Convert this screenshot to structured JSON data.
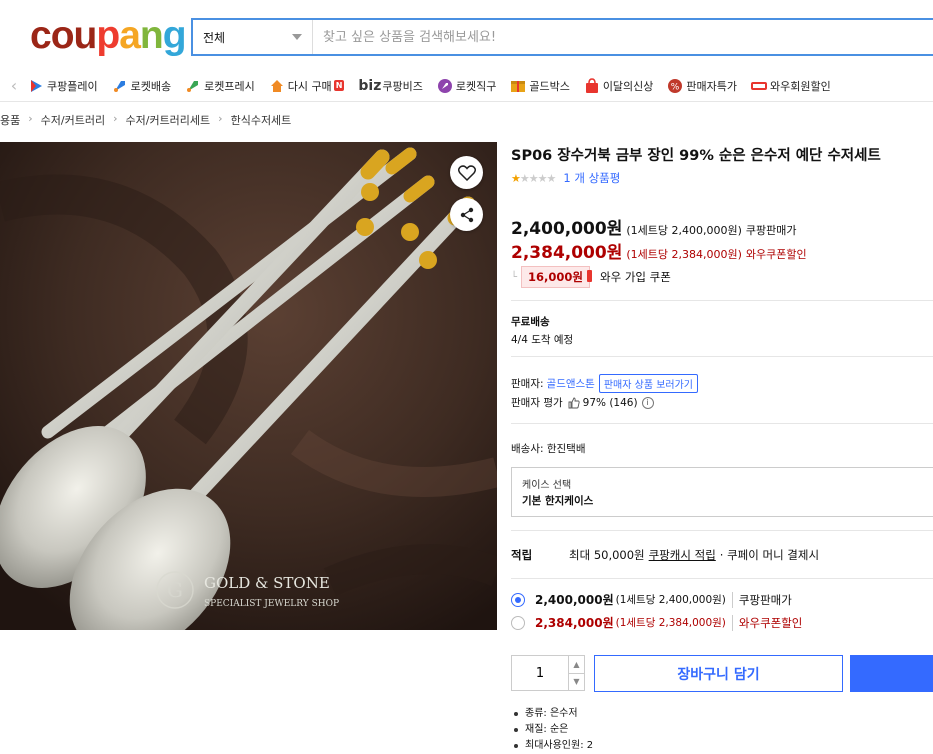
{
  "header": {
    "logo_letters": [
      {
        "ch": "c",
        "color": "#9b2617"
      },
      {
        "ch": "o",
        "color": "#9b2617"
      },
      {
        "ch": "u",
        "color": "#9b2617"
      },
      {
        "ch": "p",
        "color": "#ee3c2f"
      },
      {
        "ch": "a",
        "color": "#f5a623"
      },
      {
        "ch": "n",
        "color": "#80b63c"
      },
      {
        "ch": "g",
        "color": "#33a7d9"
      }
    ],
    "search_category": "전체",
    "search_placeholder": "찾고 싶은 상품을 검색해보세요!"
  },
  "category_nav": [
    {
      "label": "쿠팡플레이",
      "icon": "coupang-play-icon",
      "color": "#2c7de0"
    },
    {
      "label": "로켓배송",
      "icon": "rocket-icon",
      "color": "#2c7de0"
    },
    {
      "label": "로켓프레시",
      "icon": "rocket-fresh-icon",
      "color": "#3aa655"
    },
    {
      "label": "다시 구매",
      "icon": "house-icon",
      "color": "#f08a24",
      "badge": "N"
    },
    {
      "label": "쿠팡비즈",
      "prefix": "biz",
      "icon": "biz-icon"
    },
    {
      "label": "로켓직구",
      "icon": "rocket-global-icon",
      "color": "#8e44ad"
    },
    {
      "label": "골드박스",
      "icon": "gold-box-icon",
      "color": "#e8a317"
    },
    {
      "label": "이달의신상",
      "icon": "new-bag-icon",
      "color": "#e8352e"
    },
    {
      "label": "판매자특가",
      "icon": "percent-icon",
      "color": "#c0392b"
    },
    {
      "label": "와우회원할인",
      "icon": "wow-icon",
      "color": "#e8352e"
    }
  ],
  "breadcrumb": [
    "용품",
    "수저/커트러리",
    "수저/커트러리세트",
    "한식수저세트"
  ],
  "product": {
    "title": "SP06 장수거북 금부 장인 99% 순은 은수저 예단 수저세트",
    "rating_stars": 1,
    "review_text": "1 개 상품평",
    "watermark_brand": "GOLD & STONE",
    "watermark_sub": "SPECIALIST JEWELRY SHOP",
    "price": "2,400,000원",
    "price_unit": "(1세트당 2,400,000원)",
    "price_tag": "쿠팡판매가",
    "wow_price": "2,384,000원",
    "wow_unit": "(1세트당 2,384,000원)",
    "wow_tag": "와우쿠폰할인",
    "coupon_amount": "16,000원",
    "coupon_text": "와우 가입 쿠폰",
    "free_shipping": "무료배송",
    "arrival": "4/4 도착 예정",
    "seller_label": "판매자:",
    "seller_name": "골드앤스톤",
    "seller_link": "판매자 상품 보러가기",
    "seller_rating_label": "판매자 평가",
    "seller_rating_value": "97% (146)",
    "carrier": "배송사:  한진택배",
    "option_label": "케이스 선택",
    "option_value": "기본 한지케이스",
    "reward_head": "적립",
    "reward_max": "최대 50,000원",
    "reward_link": "쿠팡캐시 적립",
    "reward_rest": "· 쿠페이 머니 결제시",
    "quantity": "1",
    "cart_button": "장바구니 담기",
    "attributes": [
      "종류: 은수저",
      "재질: 순은",
      "최대사용인원: 2"
    ]
  },
  "colors": {
    "accent": "#346aff",
    "sale_red": "#ae0000"
  }
}
